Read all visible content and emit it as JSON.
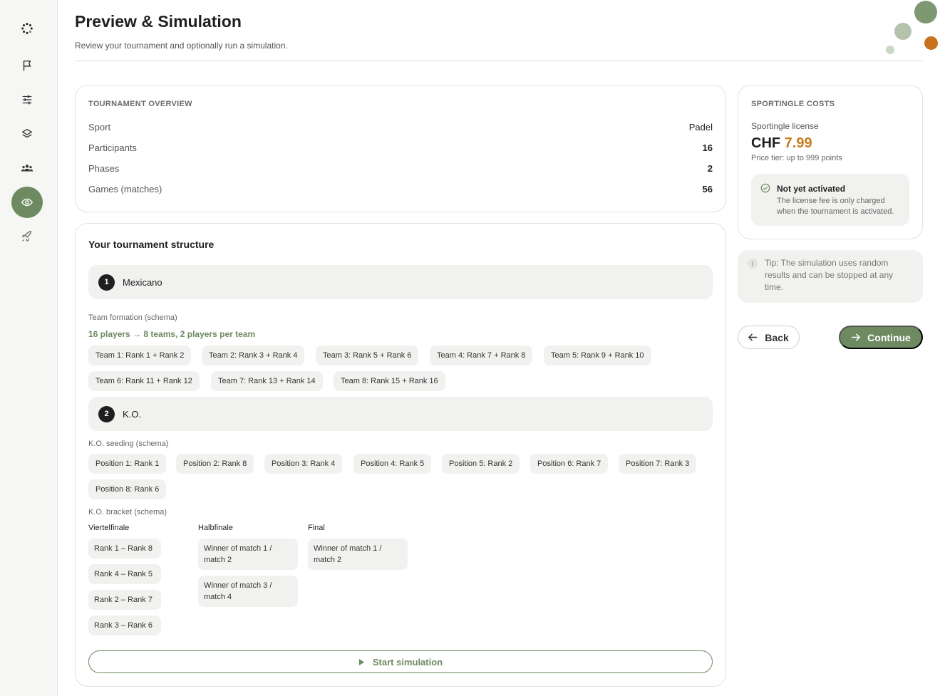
{
  "sidebar": {
    "items": [
      {
        "icon": "app-logo-icon"
      },
      {
        "icon": "flag-icon"
      },
      {
        "icon": "sliders-icon"
      },
      {
        "icon": "layers-icon"
      },
      {
        "icon": "users-icon"
      },
      {
        "icon": "eye-icon",
        "active": true
      },
      {
        "icon": "rocket-icon"
      }
    ]
  },
  "header": {
    "title": "Preview & Simulation",
    "subtitle": "Review your tournament and optionally run a simulation."
  },
  "overview": {
    "label": "TOURNAMENT OVERVIEW",
    "rows": [
      {
        "key": "Sport",
        "value": "Padel"
      },
      {
        "key": "Participants",
        "value": "16"
      },
      {
        "key": "Phases",
        "value": "2"
      },
      {
        "key": "Games (matches)",
        "value": "56"
      }
    ]
  },
  "structure": {
    "title": "Your tournament structure",
    "phase1": {
      "number": "1",
      "name": "Mexicano",
      "team_formation_label": "Team formation (schema)",
      "team_formation_summary": "16 players → 8 teams, 2 players per team",
      "teams": [
        "Team 1: Rank 1 + Rank 2",
        "Team 2: Rank 3 + Rank 4",
        "Team 3: Rank 5 + Rank 6",
        "Team 4: Rank 7 + Rank 8",
        "Team 5: Rank 9 + Rank 10",
        "Team 6: Rank 11 + Rank 12",
        "Team 7: Rank 13 + Rank 14",
        "Team 8: Rank 15 + Rank 16"
      ]
    },
    "phase2": {
      "number": "2",
      "name": "K.O.",
      "seeding_label": "K.O. seeding (schema)",
      "seeding": [
        "Position 1: Rank 1",
        "Position 2: Rank 8",
        "Position 3: Rank 4",
        "Position 4: Rank 5",
        "Position 5: Rank 2",
        "Position 6: Rank 7",
        "Position 7: Rank 3",
        "Position 8: Rank 6"
      ],
      "bracket_label": "K.O. bracket (schema)",
      "bracket": {
        "round1": {
          "title": "Viertelfinale",
          "matches": [
            "Rank 1 – Rank 8",
            "Rank 4 – Rank 5",
            "Rank 2 – Rank 7",
            "Rank 3 – Rank 6"
          ]
        },
        "round2": {
          "title": "Halbfinale",
          "matches": [
            "Winner of match 1 / match 2",
            "Winner of match 3 / match 4"
          ]
        },
        "round3": {
          "title": "Final",
          "matches": [
            "Winner of match 1 / match 2"
          ]
        }
      }
    },
    "simulate_label": "Start simulation"
  },
  "costs": {
    "label": "SPORTINGLE COSTS",
    "license_label": "Sportingle license",
    "currency": "CHF",
    "price": "7.99",
    "price_tier": "Price tier: up to 999 points",
    "status_title": "Not yet activated",
    "status_text": "The license fee is only charged when the tournament is activated."
  },
  "tip": {
    "icon": "i",
    "text": "Tip: The simulation uses random results and can be stopped at any time."
  },
  "nav": {
    "back_label": "Back",
    "continue_label": "Continue"
  },
  "colors": {
    "accent": "#6d8a61",
    "price": "#c87a1e",
    "dots": [
      "#7f9874",
      "#b5c3ad",
      "#c8711f",
      "#ccd8c6"
    ]
  }
}
